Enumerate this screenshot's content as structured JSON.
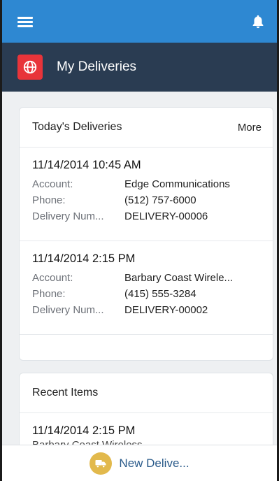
{
  "header": {
    "title": "My Deliveries"
  },
  "todays_card": {
    "title": "Today's Deliveries",
    "more_label": "More",
    "records": [
      {
        "title": "11/14/2014 10:45 AM",
        "fields": [
          {
            "label": "Account:",
            "value": "Edge Communications"
          },
          {
            "label": "Phone:",
            "value": "(512) 757-6000"
          },
          {
            "label": "Delivery Num...",
            "value": "DELIVERY-00006"
          }
        ]
      },
      {
        "title": "11/14/2014 2:15 PM",
        "fields": [
          {
            "label": "Account:",
            "value": "Barbary Coast Wirele..."
          },
          {
            "label": "Phone:",
            "value": "(415) 555-3284"
          },
          {
            "label": "Delivery Num...",
            "value": "DELIVERY-00002"
          }
        ]
      }
    ]
  },
  "recent_card": {
    "title": "Recent Items",
    "items": [
      {
        "title": "11/14/2014 2:15 PM",
        "subtitle": "Barbary Coast Wireless"
      }
    ]
  },
  "bottom_action": {
    "label": "New Delive..."
  },
  "colors": {
    "top_bar": "#2e88d2",
    "header_bar": "#2a3c52",
    "app_badge": "#e8343a",
    "action_icon": "#e2b94c"
  },
  "icons": {
    "menu": "hamburger-menu-icon",
    "notifications": "bell-icon",
    "app": "globe-icon",
    "action": "truck-icon"
  }
}
